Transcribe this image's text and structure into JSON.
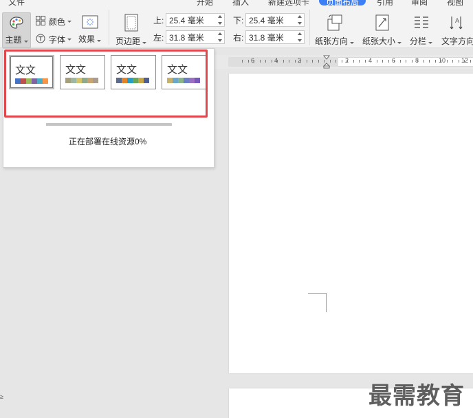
{
  "menu_tabs": {
    "file": "文件",
    "start": "开始",
    "insert": "插入",
    "newtab": "新建选项卡",
    "layout": "页面布局",
    "reference": "引用",
    "review": "审阅",
    "view": "视图"
  },
  "ribbon": {
    "theme_label": "主题",
    "color_label": "颜色",
    "font_label": "字体",
    "effect_label": "效果",
    "margin_label": "页边距",
    "top_key": "上:",
    "top_value": "25.4 毫米",
    "bottom_key": "下:",
    "bottom_value": "25.4 毫米",
    "left_key": "左:",
    "left_value": "31.8 毫米",
    "right_key": "右:",
    "right_value": "31.8 毫米",
    "orientation_label": "纸张方向",
    "size_label": "纸张大小",
    "columns_label": "分栏",
    "text_direction_label": "文字方向"
  },
  "ruler": {
    "labels": [
      "6",
      "4",
      "2",
      "2",
      "4",
      "6",
      "8",
      "10",
      "12"
    ]
  },
  "theme_panel": {
    "cards": [
      {
        "text": "文文",
        "selected": true,
        "colors": [
          "#4472c4",
          "#c0504d",
          "#9bbb59",
          "#8064a2",
          "#4bacc6",
          "#f79646"
        ]
      },
      {
        "text": "文文",
        "selected": false,
        "colors": [
          "#a5a07b",
          "#9cb8a4",
          "#d4c46a",
          "#8fa98a",
          "#c7a36f",
          "#a89c8f"
        ]
      },
      {
        "text": "文文",
        "selected": false,
        "colors": [
          "#5b6b8c",
          "#e4832e",
          "#25a0c4",
          "#6aa65a",
          "#c9a54a",
          "#4f5f8f"
        ]
      },
      {
        "text": "文文",
        "selected": false,
        "colors": [
          "#c8b26b",
          "#6ca6c8",
          "#8ab58a",
          "#6b7fc2",
          "#9b6fc2",
          "#7a58b8"
        ]
      }
    ],
    "status": "正在部署在线资源0%"
  },
  "watermark": "最需教育",
  "left_mark": "≥"
}
